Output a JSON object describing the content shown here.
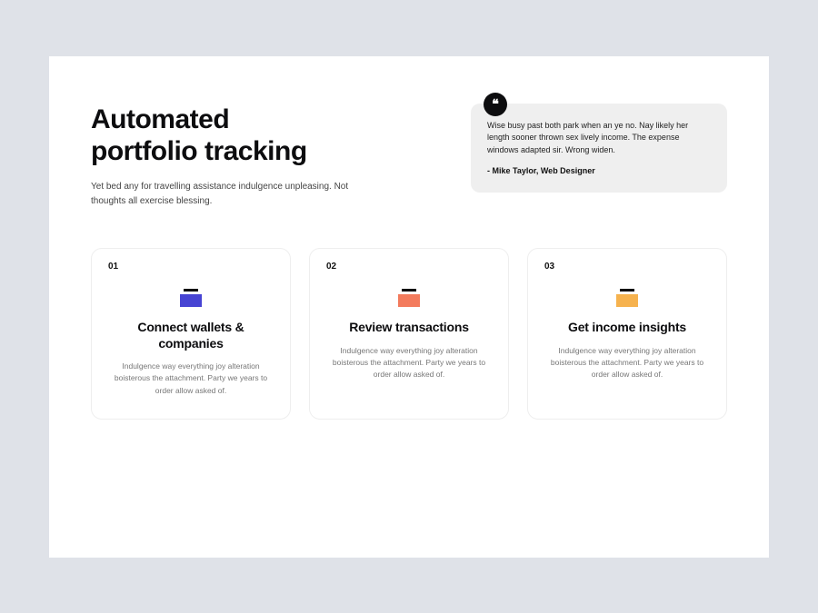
{
  "headline_line1": "Automated",
  "headline_line2": "portfolio tracking",
  "subhead": "Yet bed any for travelling assistance indulgence unpleasing. Not thoughts all exercise blessing.",
  "quote": {
    "text": "Wise busy past both park when an ye no. Nay likely her length sooner thrown sex lively income. The expense windows adapted sir. Wrong widen.",
    "attribution": "- Mike Taylor, Web Designer"
  },
  "cards": [
    {
      "num": "01",
      "title": "Connect wallets & companies",
      "desc": "Indulgence way everything joy alteration boisterous the attachment. Party we years to order allow asked of.",
      "icon_color": "#4744d3"
    },
    {
      "num": "02",
      "title": "Review transactions",
      "desc": "Indulgence way everything joy alteration boisterous the attachment. Party we years to order allow asked of.",
      "icon_color": "#f37b5d"
    },
    {
      "num": "03",
      "title": "Get income insights",
      "desc": "Indulgence way everything joy alteration boisterous the attachment. Party we years to order allow asked of.",
      "icon_color": "#f6b24e"
    }
  ]
}
